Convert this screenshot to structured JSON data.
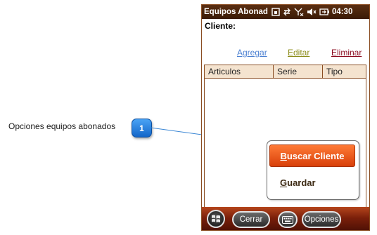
{
  "callout": {
    "label": "Opciones equipos abonados",
    "badge_number": "1",
    "badge_color": "#1a73d9"
  },
  "status_bar": {
    "title": "Equipos Abonad",
    "time": "04:30",
    "icons": [
      "screen-icon",
      "connectivity-icon",
      "signal-off-icon",
      "volume-mute-icon",
      "battery-icon"
    ]
  },
  "form": {
    "cliente_label": "Cliente:",
    "actions": {
      "agregar": "Agregar",
      "editar": "Editar",
      "eliminar": "Eliminar"
    },
    "table": {
      "columns": [
        "Articulos",
        "Serie",
        "Tipo"
      ],
      "rows": []
    }
  },
  "menu": {
    "buscar_first": "B",
    "buscar_rest": "uscar Cliente",
    "guardar_first": "G",
    "guardar_rest": "uardar"
  },
  "softkeys": {
    "cerrar": "Cerrar",
    "opciones": "Opciones"
  },
  "colors": {
    "accent": "#e8561a",
    "bar_dark": "#3a1a06",
    "link_agregar": "#4a7fd1",
    "link_editar": "#8c8c1a",
    "link_eliminar": "#8b0a1e"
  }
}
